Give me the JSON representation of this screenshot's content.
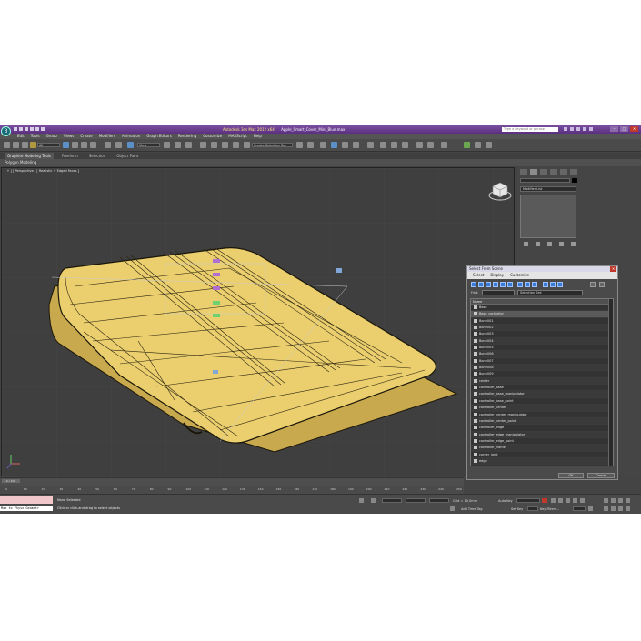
{
  "titlebar": {
    "app_title": "Autodesk 3ds Max 2012 x64",
    "file_name": "Apple_Smart_Cover_Mini_Blue.max",
    "search_placeholder": "Type a keyword or phrase",
    "workspace": "Workspace: Default"
  },
  "menu": [
    "Edit",
    "Tools",
    "Group",
    "Views",
    "Create",
    "Modifiers",
    "Animation",
    "Graph Editors",
    "Rendering",
    "Customize",
    "MAXScript",
    "Help"
  ],
  "toolbar": {
    "selection_filter": "All",
    "view_dropdown": "View",
    "named_selection": "Create Selection Set"
  },
  "ribbon": {
    "tabs": [
      "Graphite Modeling Tools",
      "Freeform",
      "Selection",
      "Object Paint"
    ],
    "active_tab": "Graphite Modeling Tools",
    "panel_label": "Polygon Modeling"
  },
  "viewport": {
    "label": "[ + ] [ Perspective ] [ Realistic + Edged Faces ]",
    "object_color": "#e8c96a",
    "wire_color": "#2a2410",
    "hud": "0 / 100"
  },
  "command_panel": {
    "modifier_list": "Modifier List"
  },
  "dialog": {
    "title": "Select From Scene",
    "menu": [
      "Select",
      "Display",
      "Customize"
    ],
    "find_label": "Find:",
    "selection_set": "Selection Set:",
    "column_header": "Name",
    "items": [
      "Base",
      "Base_controller",
      "Bone001",
      "Bone002",
      "Bone003",
      "Bone004",
      "Bone005",
      "Bone006",
      "Bone007",
      "Bone008",
      "Bone009",
      "center",
      "controller_base",
      "controller_base_manipulator",
      "controller_base_point",
      "controller_center",
      "controller_center_manipulator",
      "controller_center_point",
      "controller_edge",
      "controller_edge_manipulator",
      "controller_edge_point",
      "controller_frame",
      "corner_joint",
      "edge"
    ],
    "selected_index": 1,
    "ok": "OK",
    "cancel": "Cancel"
  },
  "timeline": {
    "slider": "0 / 100",
    "ticks": [
      "0",
      "10",
      "20",
      "30",
      "40",
      "50",
      "60",
      "70",
      "80",
      "90",
      "100",
      "110",
      "120",
      "130",
      "140",
      "150",
      "160",
      "170",
      "180",
      "190",
      "200",
      "210",
      "220",
      "230",
      "240",
      "250"
    ]
  },
  "status": {
    "maxscript_listener": "Max to Physx Geometr",
    "selection": "None Selected",
    "prompt": "Click or click-and-drag to select objects",
    "add_time_tag": "Add Time Tag",
    "set_key": "Set Key",
    "key_filters": "Key Filters...",
    "auto_key": "Auto Key",
    "selected": "Selected",
    "grid": "Grid = 10,0mm"
  }
}
